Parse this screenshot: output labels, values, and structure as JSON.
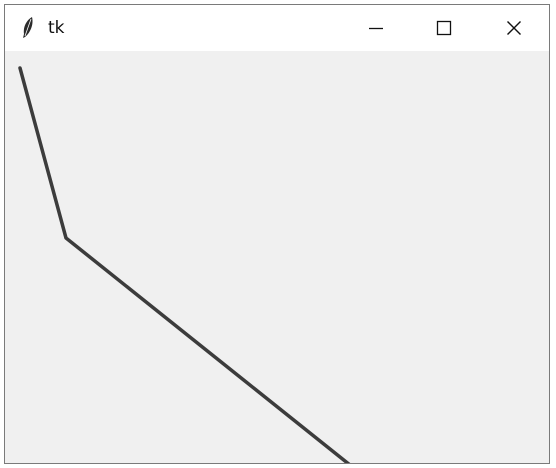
{
  "window": {
    "title": "tk"
  },
  "titlebar": {
    "app_icon": "feather-icon",
    "buttons": [
      "minimize-icon",
      "maximize-icon",
      "close-icon"
    ]
  },
  "canvas": {
    "line_color": "#3c3c3c",
    "background": "#f0f0f0"
  }
}
